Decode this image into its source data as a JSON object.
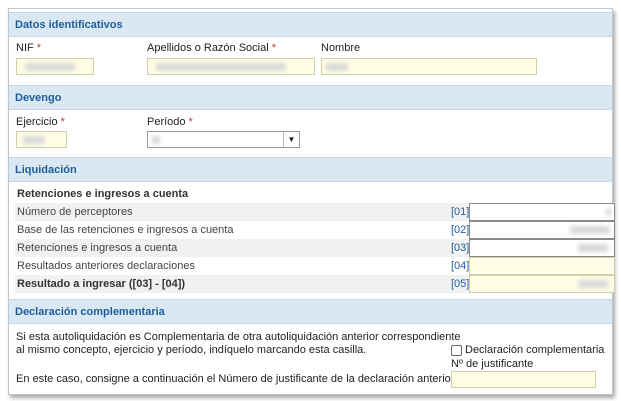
{
  "identificacion": {
    "title": "Datos identificativos",
    "nif_label": "NIF",
    "apellidos_label": "Apellidos o Razón Social",
    "nombre_label": "Nombre",
    "required_mark": "*"
  },
  "devengo": {
    "title": "Devengo",
    "ejercicio_label": "Ejercicio",
    "periodo_label": "Período",
    "required_mark": "*"
  },
  "liquidacion": {
    "title": "Liquidación",
    "subtitle": "Retenciones e ingresos a cuenta",
    "rows": [
      {
        "label": "Número de perceptores",
        "code": "[01]"
      },
      {
        "label": "Base de las retenciones e ingresos a cuenta",
        "code": "[02]"
      },
      {
        "label": "Retenciones e ingresos a cuenta",
        "code": "[03]"
      },
      {
        "label": "Resultados anteriores declaraciones",
        "code": "[04]"
      },
      {
        "label": "Resultado a ingresar ([03] - [04])",
        "code": "[05]"
      }
    ]
  },
  "complementaria": {
    "title": "Declaración complementaria",
    "text_line1": "Si esta autoliquidación es Complementaria de otra autoliquidación anterior correspondiente",
    "text_line2": "al mismo concepto, ejercicio y período, indíquelo marcando esta casilla.",
    "text_line3": "En este caso, consigne a continuación el Número de justificante de la declaración anterior.",
    "checkbox_label": "Declaración complementaria",
    "justificante_label": "Nº de justificante"
  }
}
